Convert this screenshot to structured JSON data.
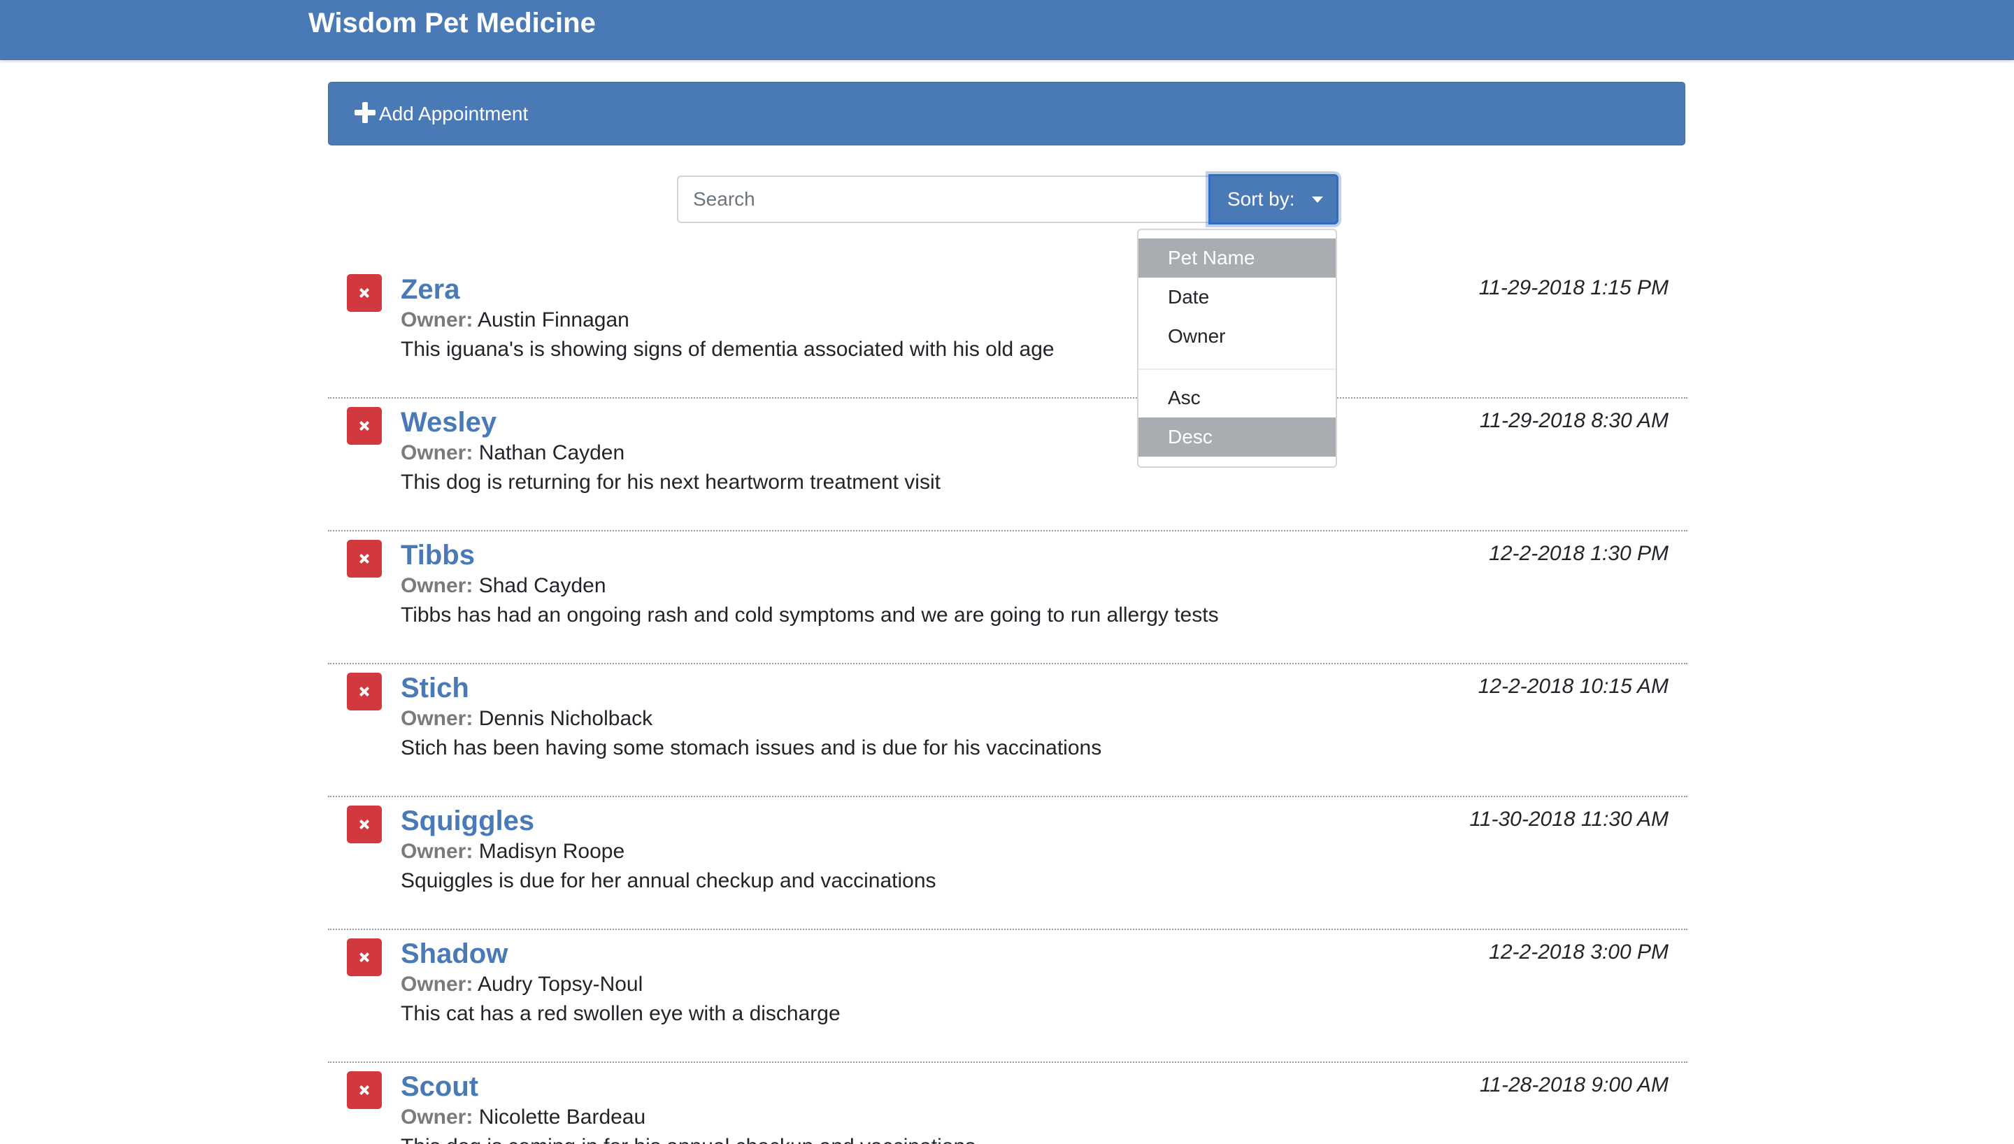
{
  "app": {
    "title": "Wisdom Pet Medicine"
  },
  "add_appointment": {
    "label": "Add Appointment",
    "icon": "plus-icon"
  },
  "search": {
    "placeholder": "Search",
    "value": ""
  },
  "sort": {
    "button_label": "Sort by:",
    "field_options": [
      "Pet Name",
      "Date",
      "Owner"
    ],
    "order_options": [
      "Asc",
      "Desc"
    ],
    "selected_field": "Pet Name",
    "selected_order": "Desc"
  },
  "appointments": {
    "owner_label": "Owner:",
    "items": [
      {
        "pet": "Zera",
        "owner": "Austin Finnagan",
        "notes": "This iguana's is showing signs of dementia associated with his old age",
        "date": "11-29-2018 1:15 PM"
      },
      {
        "pet": "Wesley",
        "owner": "Nathan Cayden",
        "notes": "This dog is returning for his next heartworm treatment visit",
        "date": "11-29-2018 8:30 AM"
      },
      {
        "pet": "Tibbs",
        "owner": "Shad Cayden",
        "notes": "Tibbs has had an ongoing rash and cold symptoms and we are going to run allergy tests",
        "date": "12-2-2018 1:30 PM"
      },
      {
        "pet": "Stich",
        "owner": "Dennis Nicholback",
        "notes": "Stich has been having some stomach issues and is due for his vaccinations",
        "date": "12-2-2018 10:15 AM"
      },
      {
        "pet": "Squiggles",
        "owner": "Madisyn Roope",
        "notes": "Squiggles is due for her annual checkup and vaccinations",
        "date": "11-30-2018 11:30 AM"
      },
      {
        "pet": "Shadow",
        "owner": "Audry Topsy-Noul",
        "notes": "This cat has a red swollen eye with a discharge",
        "date": "12-2-2018 3:00 PM"
      },
      {
        "pet": "Scout",
        "owner": "Nicolette Bardeau",
        "notes": "This dog is coming in for his annual checkup and vaccinations",
        "date": "11-28-2018 9:00 AM"
      }
    ]
  },
  "colors": {
    "brand": "#4a7ab5",
    "delete": "#d2393f",
    "dropdown_active": "#a9acb0"
  }
}
